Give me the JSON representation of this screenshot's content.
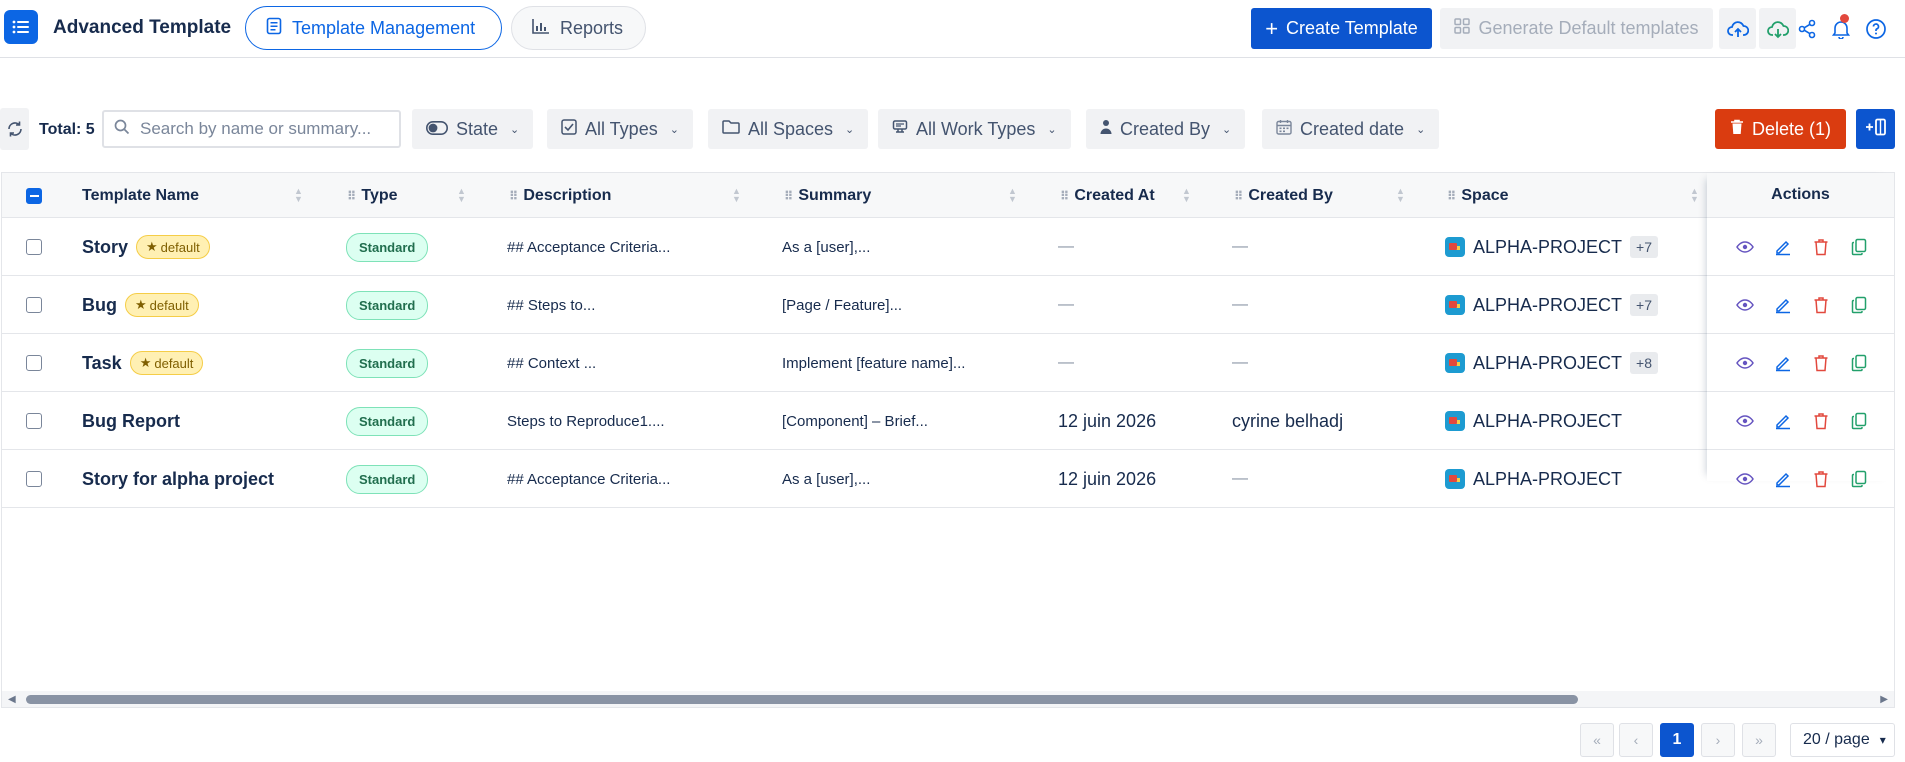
{
  "header": {
    "app_title": "Advanced Template",
    "tabs": [
      {
        "label": "Template Management",
        "icon": "document-list-icon",
        "active": true
      },
      {
        "label": "Reports",
        "icon": "bar-chart-icon",
        "active": false
      }
    ],
    "create_label": "Create Template",
    "generate_label": "Generate Default templates",
    "icons": [
      "upload-cloud-icon",
      "download-cloud-icon",
      "share-icon",
      "bell-icon",
      "help-icon"
    ]
  },
  "toolbar": {
    "total_label": "Total: 5",
    "search_placeholder": "Search by name or summary...",
    "filters": [
      {
        "label": "State",
        "icon": "toggle-icon"
      },
      {
        "label": "All Types",
        "icon": "checkbox-icon"
      },
      {
        "label": "All Spaces",
        "icon": "folder-icon"
      },
      {
        "label": "All Work Types",
        "icon": "layers-icon"
      },
      {
        "label": "Created By",
        "icon": "person-icon"
      },
      {
        "label": "Created date",
        "icon": "calendar-icon"
      }
    ],
    "delete_label": "Delete (1)"
  },
  "table": {
    "columns": [
      "Template Name",
      "Type",
      "Description",
      "Summary",
      "Created At",
      "Created By",
      "Space",
      "Actions"
    ],
    "rows": [
      {
        "name": "Story",
        "default": "default",
        "type": "Standard",
        "description": "## Acceptance Criteria...",
        "summary": "As a [user],...",
        "created_at": "—",
        "created_by": "—",
        "space": "ALPHA-PROJECT",
        "extra": "+7"
      },
      {
        "name": "Bug",
        "default": "default",
        "type": "Standard",
        "description": "## Steps to...",
        "summary": "[Page / Feature]...",
        "created_at": "—",
        "created_by": "—",
        "space": "ALPHA-PROJECT",
        "extra": "+7"
      },
      {
        "name": "Task",
        "default": "default",
        "type": "Standard",
        "description": "## Context ...",
        "summary": "Implement [feature name]...",
        "created_at": "—",
        "created_by": "—",
        "space": "ALPHA-PROJECT",
        "extra": "+8"
      },
      {
        "name": "Bug Report",
        "default": "",
        "type": "Standard",
        "description": "Steps to Reproduce1....",
        "summary": "[Component] – Brief...",
        "created_at": "12 juin 2026",
        "created_by": "cyrine belhadj",
        "space": "ALPHA-PROJECT",
        "extra": ""
      },
      {
        "name": "Story for alpha project",
        "default": "",
        "type": "Standard",
        "description": "## Acceptance Criteria...",
        "summary": "As a [user],...",
        "created_at": "12 juin 2026",
        "created_by": "—",
        "space": "ALPHA-PROJECT",
        "extra": ""
      }
    ]
  },
  "pagination": {
    "first": "«",
    "prev": "‹",
    "current": "1",
    "next": "›",
    "last": "»",
    "page_size": "20 / page"
  },
  "colors": {
    "primary": "#0c55cf",
    "danger": "#da3c10",
    "default_badge": "#fff0b3",
    "standard_badge": "#dcfff1"
  }
}
